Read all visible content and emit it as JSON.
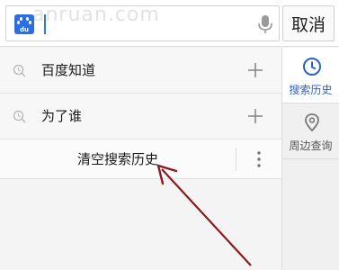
{
  "watermark": "anruan.com",
  "search": {
    "placeholder": "",
    "value": "",
    "cancel_label": "取消",
    "logo_text": "du"
  },
  "history": {
    "items": [
      {
        "label": "百度知道"
      },
      {
        "label": "为了谁"
      }
    ],
    "clear_label": "清空搜索历史"
  },
  "side_tabs": [
    {
      "label": "搜索历史",
      "icon": "clock-icon",
      "active": true
    },
    {
      "label": "周边查询",
      "icon": "location-pin-icon",
      "active": false
    }
  ],
  "colors": {
    "accent": "#2a62c9",
    "logo": "#2b6fe0",
    "arrow": "#8b1a1a"
  }
}
